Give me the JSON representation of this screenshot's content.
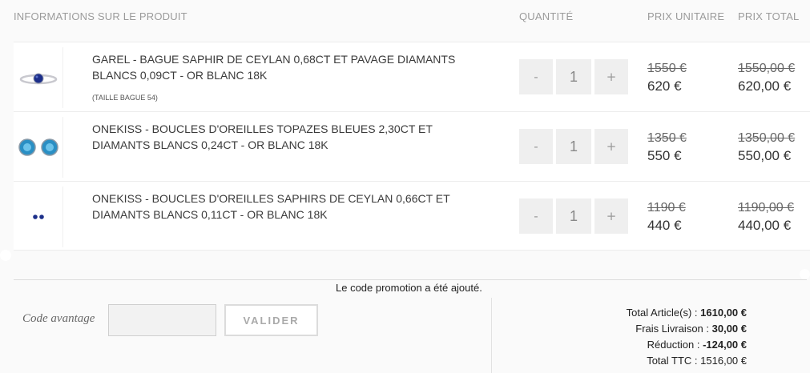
{
  "header": {
    "info": "INFORMATIONS SUR LE PRODUIT",
    "quantity": "QUANTITÉ",
    "unit_price": "PRIX UNITAIRE",
    "total_price": "PRIX TOTAL"
  },
  "items": [
    {
      "name": "GAREL - BAGUE SAPHIR DE CEYLAN 0,68CT ET PAVAGE DIAMANTS BLANCS 0,09CT - OR BLANC 18K",
      "variant": "(TAILLE BAGUE 54)",
      "qty_minus": "-",
      "qty": "1",
      "qty_plus": "+",
      "unit_old": "1550 €",
      "unit_new": "620 €",
      "total_old": "1550,00 €",
      "total_new": "620,00 €",
      "image_icon": "sapphire-ring-icon"
    },
    {
      "name": "ONEKISS - BOUCLES D'OREILLES TOPAZES BLEUES 2,30CT ET DIAMANTS BLANCS 0,24CT - OR BLANC 18K",
      "variant": "",
      "qty_minus": "-",
      "qty": "1",
      "qty_plus": "+",
      "unit_old": "1350 €",
      "unit_new": "550 €",
      "total_old": "1350,00 €",
      "total_new": "550,00 €",
      "image_icon": "topaz-earrings-icon"
    },
    {
      "name": "ONEKISS - BOUCLES D'OREILLES SAPHIRS DE CEYLAN 0,66CT ET DIAMANTS BLANCS 0,11CT - OR BLANC 18K",
      "variant": "",
      "qty_minus": "-",
      "qty": "1",
      "qty_plus": "+",
      "unit_old": "1190 €",
      "unit_new": "440 €",
      "total_old": "1190,00 €",
      "total_new": "440,00 €",
      "image_icon": "sapphire-earrings-icon"
    }
  ],
  "promo": {
    "message": "Le code promotion a été ajouté.",
    "label": "Code avantage",
    "input_value": "",
    "button": "VALIDER"
  },
  "totals": {
    "articles_label": "Total Article(s) :",
    "articles_value": "1610,00 €",
    "shipping_label": "Frais Livraison :",
    "shipping_value": "30,00 €",
    "discount_label": "Réduction :",
    "discount_value": "-124,00 €",
    "ttc_label": "Total TTC :",
    "ttc_value": "1516,00 €"
  },
  "colors": {
    "background": "#fafafa",
    "muted_text": "#9b9b9b",
    "sapphire": "#1c2f8a",
    "topaz": "#2a8fc4"
  }
}
